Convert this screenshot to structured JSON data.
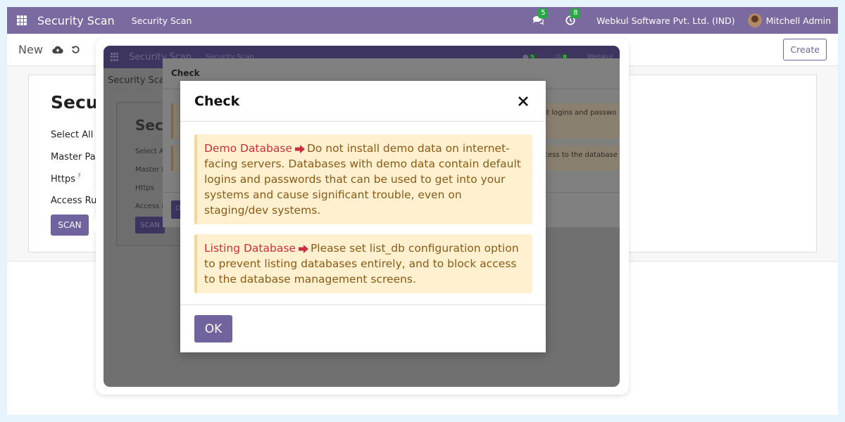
{
  "navbar": {
    "app_name": "Security Scan",
    "menu_item": "Security Scan",
    "messages_count": "5",
    "activities_count": "8",
    "company": "Webkul Software Pvt. Ltd. (IND)",
    "user": "Mitchell Admin"
  },
  "control_panel": {
    "breadcrumb": "New",
    "create_label": "Create"
  },
  "form": {
    "title": "Secur",
    "fields": [
      "Select All",
      "Master Pas",
      "Https",
      "Access Rule"
    ],
    "scan_label": "SCAN"
  },
  "zoom": {
    "app_name": "Security Scan",
    "menu_item": "Security Scan",
    "messages_count": "5",
    "activities_count": "8",
    "company": "Webkul",
    "breadcrumb": "Security Sca",
    "form_title": "Secu",
    "fields": [
      "Select A",
      "Master I",
      "Https",
      "Access F"
    ],
    "scan_label": "SCAN",
    "modal_title": "Check",
    "alert1_tail": "ault logins and passwo",
    "alert2_tail": "access to the database",
    "ok_label": "O"
  },
  "modal": {
    "title": "Check",
    "alerts": [
      {
        "title": "Demo Database",
        "text": "Do not install demo data on internet-facing servers. Databases with demo data contain default logins and passwords that can be used to get into your systems and cause significant trouble, even on staging/dev systems."
      },
      {
        "title": "Listing Database",
        "text": "Please set list_db configuration option to prevent listing databases entirely, and to block access to the database management screens."
      }
    ],
    "ok_label": "OK"
  },
  "colors": {
    "brand": "#7a6a9f",
    "button": "#71639e",
    "alert_bg": "#fff0cf",
    "alert_title": "#c9303f",
    "alert_text": "#8a5a16",
    "badge": "#28a745"
  }
}
